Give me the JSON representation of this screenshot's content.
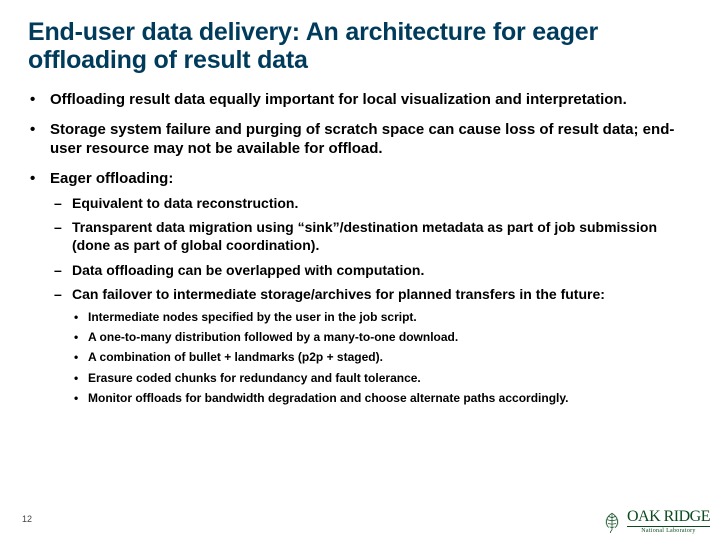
{
  "title": "End-user data delivery: An architecture for eager offloading of result data",
  "page_number": "12",
  "bullets": [
    {
      "text": "Offloading result data equally important for local visualization and interpretation."
    },
    {
      "text": "Storage system failure and purging of scratch space can cause loss of result data; end-user resource may not be available for offload."
    },
    {
      "text": "Eager offloading:",
      "children": [
        {
          "text": "Equivalent to data reconstruction."
        },
        {
          "text": "Transparent data migration using “sink”/destination metadata as part of job submission (done as part of global coordination)."
        },
        {
          "text": "Data offloading can be overlapped with computation."
        },
        {
          "text": "Can failover to intermediate storage/archives for planned transfers in the future:",
          "children": [
            {
              "text": "Intermediate nodes specified by the user in the job script."
            },
            {
              "text": "A one-to-many distribution followed by a many-to-one download."
            },
            {
              "text": "A combination of bullet + landmarks (p2p + staged)."
            },
            {
              "text": "Erasure coded chunks for redundancy and fault tolerance."
            },
            {
              "text": "Monitor offloads for bandwidth degradation and choose alternate paths accordingly."
            }
          ]
        }
      ]
    }
  ],
  "logo": {
    "main": "OAK RIDGE",
    "sub": "National Laboratory"
  }
}
